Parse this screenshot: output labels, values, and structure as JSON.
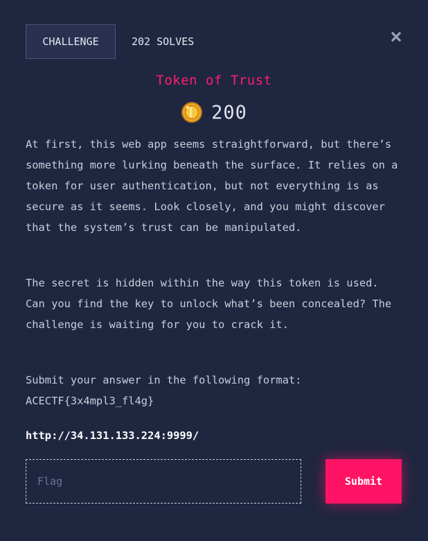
{
  "header": {
    "tab_challenge": "CHALLENGE",
    "tab_solves": "202 SOLVES",
    "close_icon": "close-x-icon"
  },
  "challenge": {
    "title": "Token of Trust",
    "points_icon": "coin-icon",
    "points": "200",
    "description": [
      "At first, this web app seems straightforward, but there’s something more lurking beneath the surface. It relies on a token for user authentication, but not everything is as secure as it seems. Look closely, and you might discover that the system’s trust can be manipulated.",
      "The secret is hidden within the way this token is used. Can you find the key to unlock what’s been concealed? The challenge is waiting for you to crack it.",
      "Submit your answer in the following format: ACECTF{3x4mpl3_fl4g}"
    ],
    "url": "http://34.131.133.224:9999/"
  },
  "form": {
    "flag_placeholder": "Flag",
    "flag_value": "",
    "submit_label": "Submit"
  },
  "colors": {
    "background": "#1f2640",
    "accent": "#ff1465",
    "title": "#ff1e6d",
    "text": "#c9cedb"
  }
}
